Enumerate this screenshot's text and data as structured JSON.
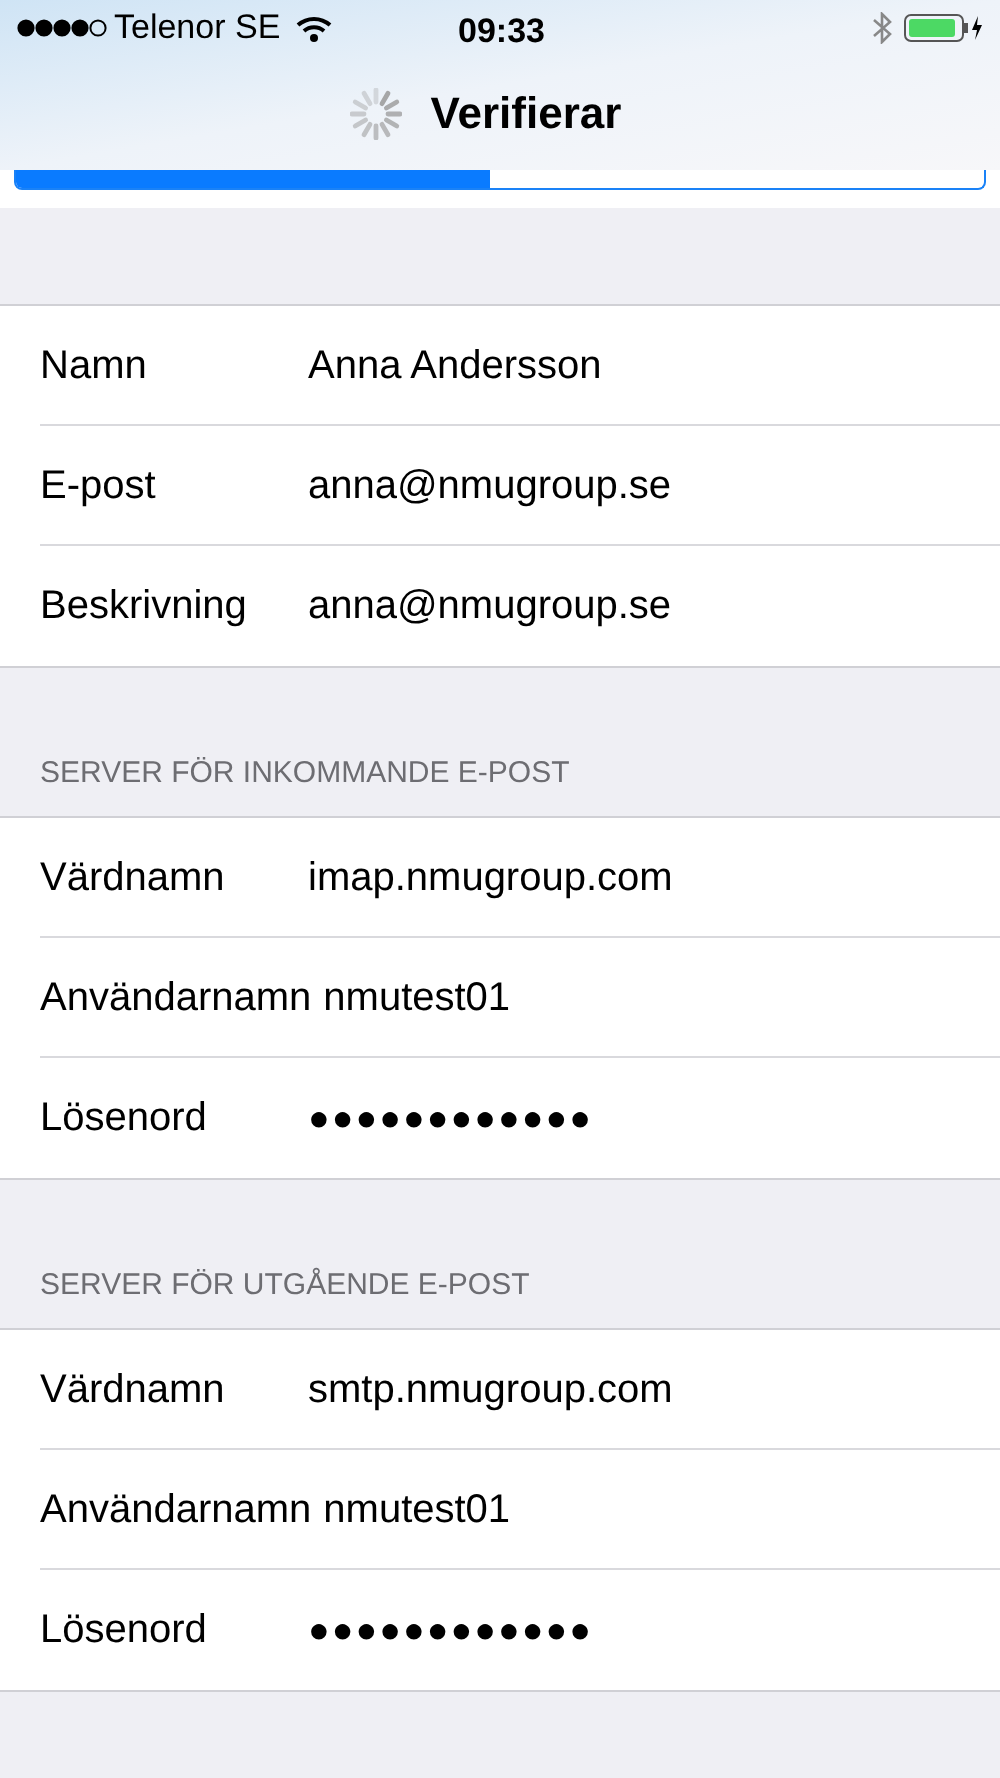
{
  "status_bar": {
    "carrier": "Telenor SE",
    "time": "09:33"
  },
  "nav": {
    "title": "Verifierar"
  },
  "progress": {
    "level": 0.49
  },
  "account": [
    {
      "label": "Namn",
      "value": "Anna Andersson",
      "kind": "text"
    },
    {
      "label": "E-post",
      "value": "anna@nmugroup.se",
      "kind": "text"
    },
    {
      "label": "Beskrivning",
      "value": "anna@nmugroup.se",
      "kind": "text"
    }
  ],
  "sections": [
    {
      "header": "SERVER FÖR INKOMMANDE E-POST",
      "rows": [
        {
          "label": "Värdnamn",
          "value": "imap.nmugroup.com",
          "kind": "text"
        },
        {
          "label": "Användarnamn",
          "value": "nmutest01",
          "kind": "text"
        },
        {
          "label": "Lösenord",
          "value": "●●●●●●●●●●●●",
          "kind": "password"
        }
      ]
    },
    {
      "header": "SERVER FÖR UTGÅENDE E-POST",
      "rows": [
        {
          "label": "Värdnamn",
          "value": "smtp.nmugroup.com",
          "kind": "text"
        },
        {
          "label": "Användarnamn",
          "value": "nmutest01",
          "kind": "text"
        },
        {
          "label": "Lösenord",
          "value": "●●●●●●●●●●●●",
          "kind": "password"
        }
      ]
    }
  ]
}
